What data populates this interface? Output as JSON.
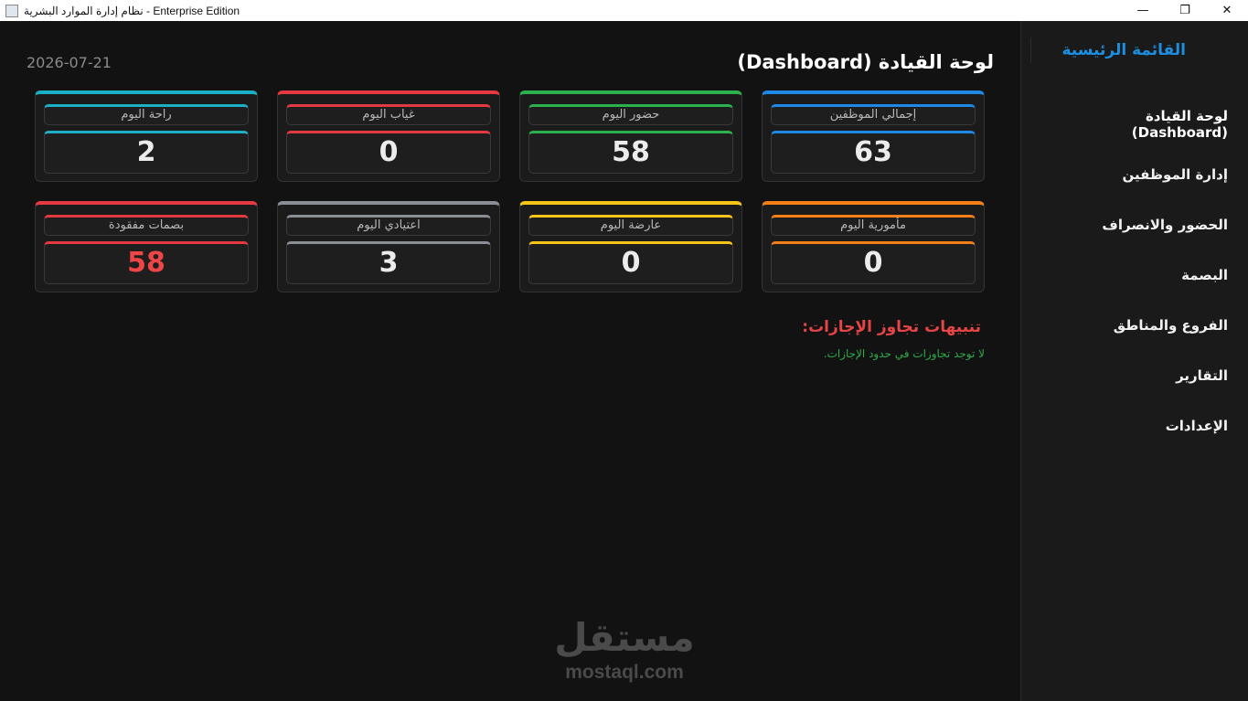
{
  "window": {
    "title": "نظام إدارة الموارد البشرية - Enterprise Edition",
    "minimize": "—",
    "maximize": "❐",
    "close": "✕"
  },
  "sidebar": {
    "title": "القائمة الرئيسية",
    "items": [
      {
        "label": "لوحة القيادة (Dashboard)"
      },
      {
        "label": "إدارة الموظفين"
      },
      {
        "label": "الحضور والانصراف"
      },
      {
        "label": "البصمة"
      },
      {
        "label": "الفروع والمناطق"
      },
      {
        "label": "التقارير"
      },
      {
        "label": "الإعدادات"
      }
    ]
  },
  "header": {
    "title": "لوحة القيادة (Dashboard)",
    "date": "2026-07-21"
  },
  "stats": [
    {
      "label": "إجمالي الموظفين",
      "value": "63",
      "color": "#1e88e5"
    },
    {
      "label": "حضور اليوم",
      "value": "58",
      "color": "#2bb24c"
    },
    {
      "label": "غياب اليوم",
      "value": "0",
      "color": "#e53941"
    },
    {
      "label": "راحة اليوم",
      "value": "2",
      "color": "#1bb0c6"
    },
    {
      "label": "مأمورية اليوم",
      "value": "0",
      "color": "#f57f17"
    },
    {
      "label": "عارضة اليوم",
      "value": "0",
      "color": "#f5c518"
    },
    {
      "label": "اعتيادي اليوم",
      "value": "3",
      "color": "#8a8f95"
    },
    {
      "label": "بصمات مفقودة",
      "value": "58",
      "color": "#e53941"
    }
  ],
  "alerts": {
    "title": "تنبيهات تجاوز الإجازات:",
    "message": "لا توجد تجاوزات في حدود الإجازات."
  },
  "watermark": {
    "logo": "مستقل",
    "url": "mostaql.com"
  }
}
